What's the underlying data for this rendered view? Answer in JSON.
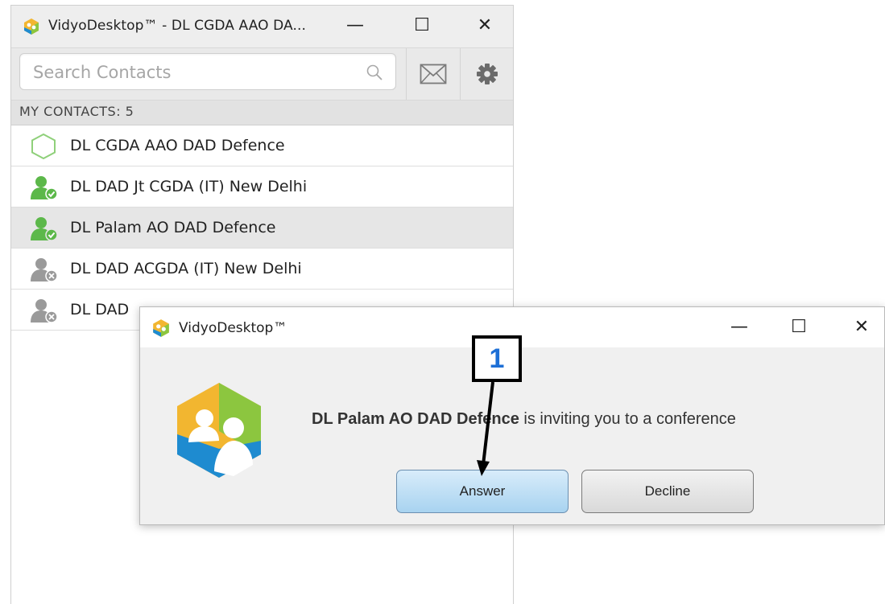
{
  "main_window": {
    "title": "VidyoDesktop™  - DL CGDA AAO DA...",
    "controls": {
      "minimize": "—",
      "maximize": "☐",
      "close": "✕"
    }
  },
  "toolbar": {
    "search_placeholder": "Search Contacts",
    "search_value": ""
  },
  "contacts": {
    "header": "MY CONTACTS: 5",
    "items": [
      {
        "name": "DL CGDA AAO DAD Defence",
        "status": "self"
      },
      {
        "name": "DL DAD Jt CGDA (IT) New Delhi",
        "status": "online"
      },
      {
        "name": "DL Palam AO DAD Defence",
        "status": "online"
      },
      {
        "name": "DL DAD ACGDA (IT) New Delhi",
        "status": "offline"
      },
      {
        "name": "DL DAD",
        "status": "offline"
      }
    ]
  },
  "dialog": {
    "title": "VidyoDesktop™",
    "caller": "DL Palam AO DAD Defence",
    "message": " is inviting you to a conference",
    "answer_label": "Answer",
    "decline_label": "Decline"
  },
  "annotation": {
    "step_number": "1"
  },
  "colors": {
    "online_green": "#5cb84a",
    "offline_gray": "#9a9a9a",
    "answer_blue": "#a8d3f0",
    "step_number_blue": "#1d6fd6"
  }
}
